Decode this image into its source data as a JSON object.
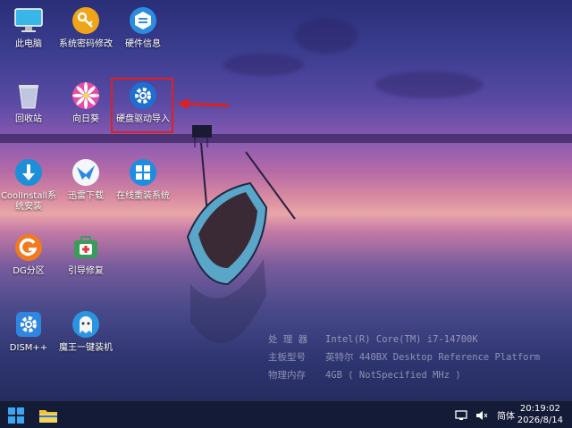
{
  "desktop_icons": [
    {
      "id": "pc",
      "label": "此电脑",
      "icon": "monitor-icon"
    },
    {
      "id": "pwd",
      "label": "系统密码修改",
      "icon": "key-icon"
    },
    {
      "id": "hw",
      "label": "硬件信息",
      "icon": "hardware-info-icon"
    },
    {
      "id": "bin",
      "label": "回收站",
      "icon": "recycle-bin-icon"
    },
    {
      "id": "sunflower",
      "label": "向日葵",
      "icon": "sunflower-icon"
    },
    {
      "id": "hddriver",
      "label": "硬盘驱动导入",
      "icon": "gear-icon"
    },
    {
      "id": "coolinstall",
      "label": "CoolInstall系统安装",
      "icon": "download-arrow-icon"
    },
    {
      "id": "xunlei",
      "label": "迅雷下载",
      "icon": "bird-icon"
    },
    {
      "id": "reinstall",
      "label": "在线重装系统",
      "icon": "windows-icon"
    },
    {
      "id": "dg",
      "label": "DG分区",
      "icon": "dg-logo-icon"
    },
    {
      "id": "bootfix",
      "label": "引导修复",
      "icon": "medical-kit-icon"
    },
    {
      "id": "dism",
      "label": "DISM++",
      "icon": "gear-icon"
    },
    {
      "id": "ghost",
      "label": "魔王一键装机",
      "icon": "ghost-icon"
    }
  ],
  "sysinfo": [
    {
      "key": "处 理 器",
      "value": "Intel(R) Core(TM) i7-14700K"
    },
    {
      "key": "主板型号",
      "value": "英特尔 440BX Desktop Reference Platform"
    },
    {
      "key": "物理内存",
      "value": "4GB ( NotSpecified  MHz )"
    }
  ],
  "taskbar": {
    "ime": "简体",
    "time": "20:19:02",
    "date": "2026/8/14"
  },
  "colors": {
    "highlight": "#e02020",
    "taskbar": "#121a34"
  }
}
